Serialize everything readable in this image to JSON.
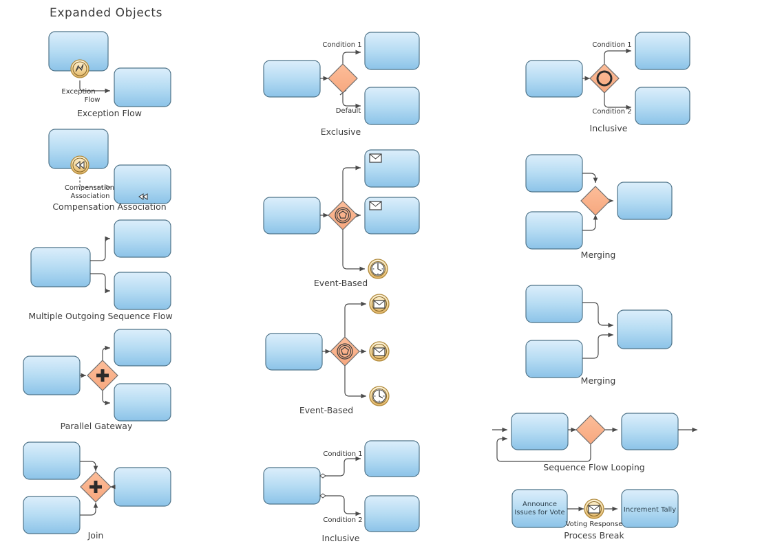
{
  "page": {
    "title": "Expanded Objects",
    "background_color": "#ffffff",
    "text_color": "#3a3a3a"
  },
  "palette": {
    "task_fill_top": "#d6eaf8",
    "task_fill_bottom": "#8ec4e8",
    "task_stroke": "#4a6b80",
    "gateway_fill": "#fab38a",
    "gateway_stroke": "#6b6b6b",
    "event_fill_top": "#fdf0d0",
    "event_fill_bottom": "#e8b96a",
    "event_stroke": "#b58b3a",
    "connector_stroke": "#555555"
  },
  "examples": [
    {
      "id": "exception-flow",
      "caption": "Exception Flow",
      "edge_labels": [
        "Exception",
        "Flow"
      ],
      "attached_event": "error-event-icon"
    },
    {
      "id": "compensation-association",
      "caption": "Compensation Association",
      "edge_labels": [
        "Compensation",
        "Association"
      ],
      "attached_event": "compensation-event-icon",
      "task_marker": "compensation-marker-icon"
    },
    {
      "id": "multiple-outgoing-sequence-flow",
      "caption": "Multiple Outgoing Sequence Flow",
      "edge_labels": []
    },
    {
      "id": "parallel-gateway",
      "caption": "Parallel Gateway",
      "edge_labels": [],
      "gateway_marker": "plus-icon"
    },
    {
      "id": "join",
      "caption": "Join",
      "edge_labels": [],
      "gateway_marker": "plus-icon"
    },
    {
      "id": "exclusive",
      "caption": "Exclusive",
      "edge_labels": [
        "Condition 1",
        "Default"
      ],
      "gateway_marker": "blank-exclusive"
    },
    {
      "id": "event-based-tasks",
      "caption": "Event-Based",
      "edge_labels": [],
      "gateway_marker": "event-based-pentagon-icon",
      "targets": [
        "message-task",
        "message-task",
        "timer-event-icon"
      ]
    },
    {
      "id": "event-based-events",
      "caption": "Event-Based",
      "edge_labels": [],
      "gateway_marker": "event-based-pentagon-icon",
      "targets": [
        "message-event-icon",
        "message-event-icon",
        "timer-event-icon"
      ]
    },
    {
      "id": "inclusive-conditional",
      "caption": "Inclusive",
      "edge_labels": [
        "Condition  1",
        "Condition  2"
      ],
      "marker": "conditional-flow-diamond"
    },
    {
      "id": "inclusive-gateway",
      "caption": "Inclusive",
      "edge_labels": [
        "Condition 1",
        "Condition 2"
      ],
      "gateway_marker": "circle-icon"
    },
    {
      "id": "merging-gateway",
      "caption": "Merging",
      "edge_labels": [],
      "gateway_marker": "blank-exclusive"
    },
    {
      "id": "merging-direct",
      "caption": "Merging",
      "edge_labels": []
    },
    {
      "id": "sequence-flow-looping",
      "caption": "Sequence Flow Looping",
      "edge_labels": [],
      "gateway_marker": "blank-exclusive"
    },
    {
      "id": "process-break",
      "caption": "Process Break",
      "edge_labels": [
        "Voting Response"
      ],
      "tasks": [
        "Announce Issues for Vote",
        "Increment Tally"
      ],
      "event": "message-event-icon"
    }
  ],
  "labels": {
    "title": "Expanded Objects",
    "exception_flow_caption": "Exception Flow",
    "exception_flow_edge_line1": "Exception",
    "exception_flow_edge_line2": "Flow",
    "compensation_caption": "Compensation Association",
    "compensation_edge_line1": "Compensation",
    "compensation_edge_line2": "Association",
    "multiple_outgoing_caption": "Multiple Outgoing Sequence Flow",
    "parallel_gateway_caption": "Parallel Gateway",
    "join_caption": "Join",
    "exclusive_caption": "Exclusive",
    "exclusive_condition_1": "Condition 1",
    "exclusive_default": "Default",
    "event_based_caption_1": "Event-Based",
    "event_based_caption_2": "Event-Based",
    "inclusive_cond_caption": "Inclusive",
    "inclusive_cond_1": "Condition  1",
    "inclusive_cond_2": "Condition  2",
    "inclusive_gw_caption": "Inclusive",
    "inclusive_gw_cond_1": "Condition 1",
    "inclusive_gw_cond_2": "Condition 2",
    "merging_caption_1": "Merging",
    "merging_caption_2": "Merging",
    "looping_caption": "Sequence Flow Looping",
    "process_break_caption": "Process Break",
    "process_break_edge": "Voting Response",
    "process_break_task_1_line1": "Announce",
    "process_break_task_1_line2": "Issues for Vote",
    "process_break_task_2": "Increment Tally"
  }
}
